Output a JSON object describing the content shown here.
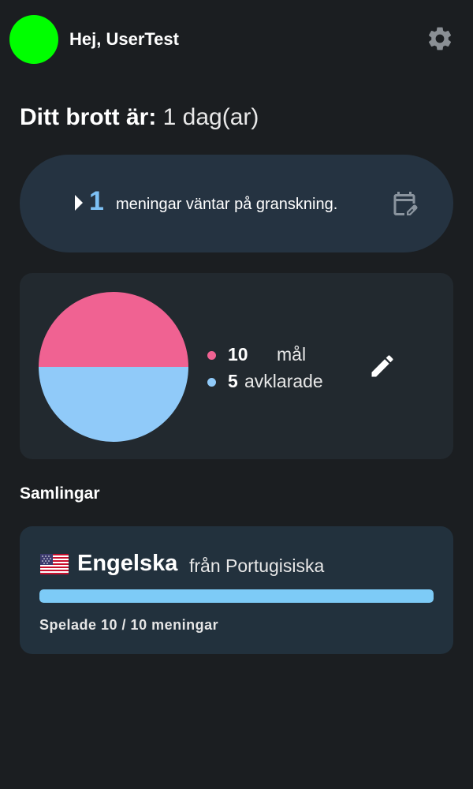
{
  "header": {
    "greeting": "Hej, UserTest",
    "avatar_color": "#00ff00",
    "settings_icon": "gear-icon"
  },
  "streak": {
    "label": "Ditt brott är:",
    "value": "1 dag(ar)"
  },
  "review": {
    "count": "1",
    "text": "meningar väntar på granskning.",
    "expand_icon": "play-arrow-icon",
    "calendar_icon": "calendar-edit-icon"
  },
  "goals": {
    "target_count": "10",
    "target_label": "mål",
    "done_count": "5",
    "done_label": "avklarade",
    "target_color": "#f06292",
    "done_color": "#90caf9",
    "edit_icon": "pencil-icon"
  },
  "collections": {
    "title": "Samlingar",
    "items": [
      {
        "flag_icon": "us-flag-icon",
        "language": "Engelska",
        "from": "från Portugisiska",
        "progress": 1.0,
        "played": "Spelade 10 / 10 meningar"
      }
    ]
  },
  "colors": {
    "background": "#1b1e21",
    "card": "#22292f",
    "review_card": "#253341",
    "accent": "#7dc1f5"
  }
}
